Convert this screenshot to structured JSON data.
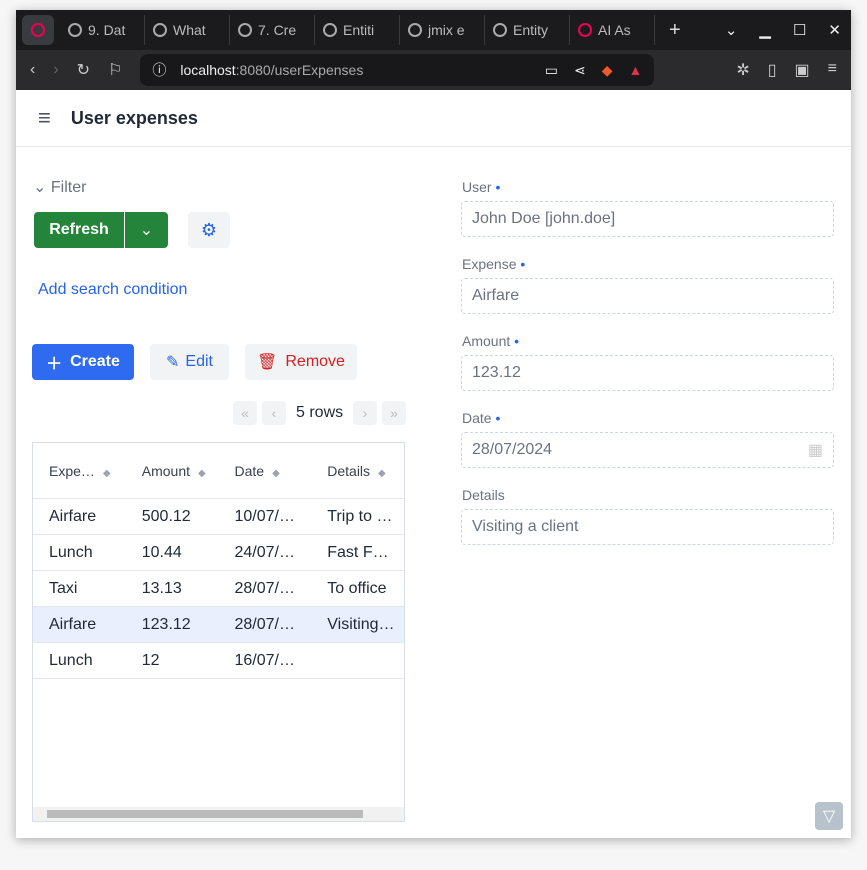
{
  "browser": {
    "tabs": [
      "9. Dat",
      "What",
      "7. Cre",
      "Entiti",
      "jmix e",
      "Entity",
      "AI As"
    ],
    "url_host": "localhost",
    "url_rest": ":8080/userExpenses"
  },
  "app": {
    "title": "User expenses"
  },
  "filter": {
    "label": "Filter",
    "refresh": "Refresh",
    "add_condition": "Add search condition"
  },
  "toolbar": {
    "create": "Create",
    "edit": "Edit",
    "remove": "Remove",
    "rows": "5 rows"
  },
  "table": {
    "headers": [
      "Expe…",
      "Amount",
      "Date",
      "Details"
    ],
    "rows": [
      [
        "Airfare",
        "500.12",
        "10/07/…",
        "Trip to …"
      ],
      [
        "Lunch",
        "10.44",
        "24/07/…",
        "Fast F…"
      ],
      [
        "Taxi",
        "13.13",
        "28/07/…",
        "To office"
      ],
      [
        "Airfare",
        "123.12",
        "28/07/…",
        "Visiting…"
      ],
      [
        "Lunch",
        "12",
        "16/07/…",
        ""
      ]
    ]
  },
  "form": {
    "user_label": "User",
    "user": "John Doe [john.doe]",
    "expense_label": "Expense",
    "expense": "Airfare",
    "amount_label": "Amount",
    "amount": "123.12",
    "date_label": "Date",
    "date": "28/07/2024",
    "details_label": "Details",
    "details": "Visiting a client"
  }
}
